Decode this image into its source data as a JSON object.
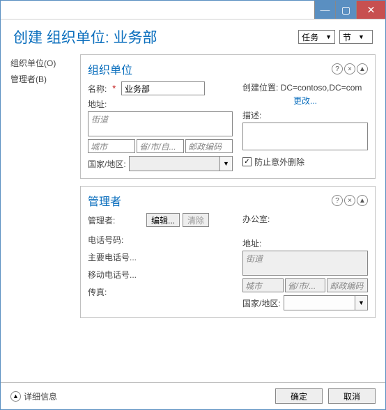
{
  "window": {
    "minimize": "—",
    "maximize": "▢",
    "close": "✕"
  },
  "header": {
    "title": "创建 组织单位: 业务部",
    "task_combo": "任务",
    "section_combo": "节"
  },
  "sidebar": {
    "item_ou": "组织单位(O)",
    "item_manager": "管理者(B)"
  },
  "section_ou": {
    "title": "组织单位",
    "help": "?",
    "close": "×",
    "collapse": "▲",
    "name_label": "名称:",
    "required": "*",
    "name_value": "业务部",
    "address_label": "地址:",
    "street_placeholder": "街道",
    "city_placeholder": "城市",
    "state_placeholder": "省/市/自...",
    "postal_placeholder": "邮政编码",
    "country_label": "国家/地区:",
    "create_loc_label": "创建位置:",
    "create_loc_value": "DC=contoso,DC=com",
    "change_link": "更改...",
    "desc_label": "描述:",
    "prevent_delete": "防止意外删除",
    "check_mark": "✓"
  },
  "section_mgr": {
    "title": "管理者",
    "help": "?",
    "close": "×",
    "collapse": "▲",
    "manager_label": "管理者:",
    "edit_btn": "编辑...",
    "clear_btn": "清除",
    "phone_label": "电话号码:",
    "main_phone_label": "主要电话号...",
    "mobile_label": "移动电话号...",
    "fax_label": "传真:",
    "office_label": "办公室:",
    "address_label": "地址:",
    "street_placeholder": "街道",
    "city_placeholder": "城市",
    "state_placeholder": "省/市/...",
    "postal_placeholder": "邮政编码",
    "country_label": "国家/地区:"
  },
  "footer": {
    "expand": "▲",
    "details": "详细信息",
    "ok": "确定",
    "cancel": "取消"
  }
}
